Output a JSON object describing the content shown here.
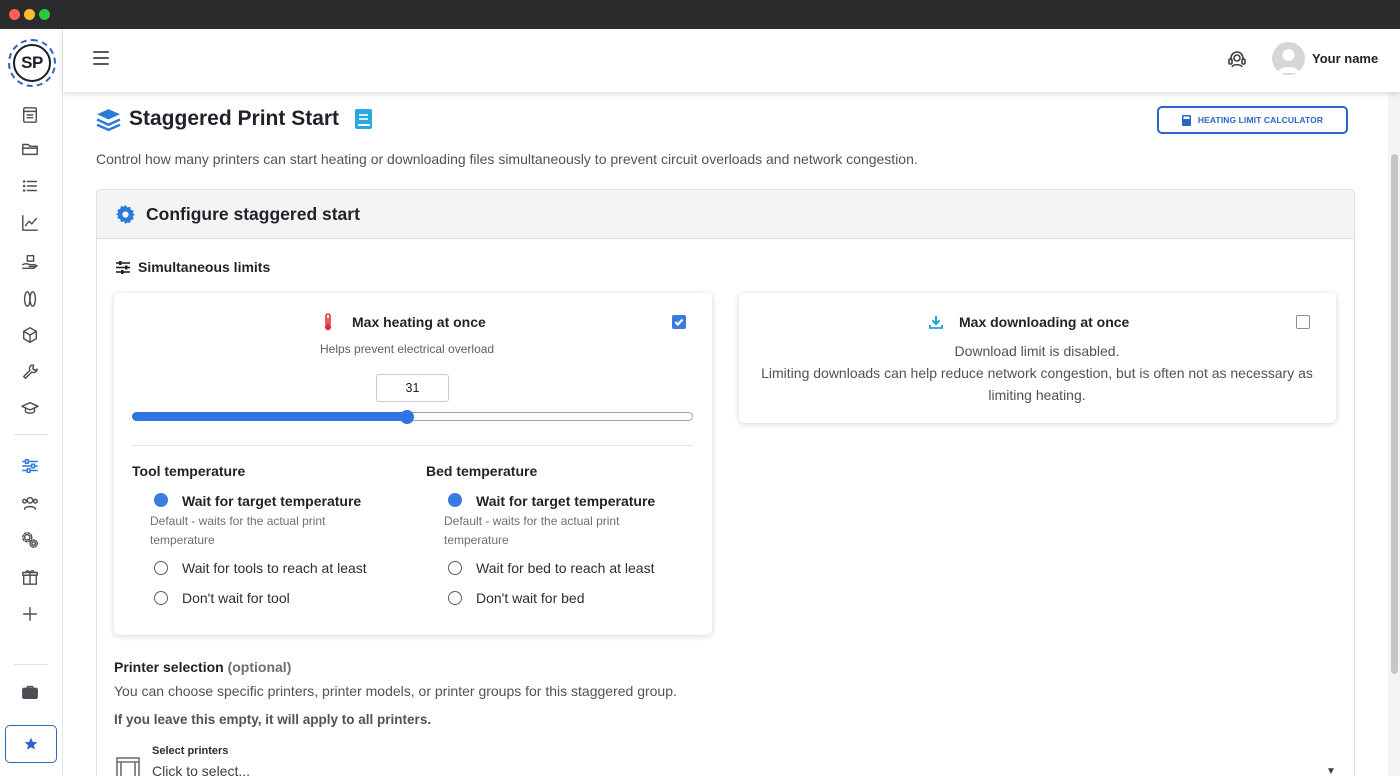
{
  "app": {
    "logo_text": "SP",
    "username": "Your name"
  },
  "colors": {
    "accent": "#2a66c9",
    "slider": "#2f74e0",
    "heat_icon": "#e0303c",
    "download_icon": "#1ea3d8"
  },
  "sidebar": {
    "items": [
      {
        "icon": "dashboard-icon"
      },
      {
        "icon": "folder-icon"
      },
      {
        "icon": "list-icon"
      },
      {
        "icon": "chart-icon"
      },
      {
        "icon": "hand-box-icon"
      },
      {
        "icon": "spool-icon"
      },
      {
        "icon": "cube-icon"
      },
      {
        "icon": "wrench-icon"
      },
      {
        "icon": "graduation-cap-icon"
      },
      {
        "icon": "sliders-icon",
        "active": true
      },
      {
        "icon": "users-icon"
      },
      {
        "icon": "gears-icon"
      },
      {
        "icon": "gift-icon"
      },
      {
        "icon": "plus-icon"
      },
      {
        "icon": "briefcase-icon"
      },
      {
        "icon": "star-icon"
      }
    ]
  },
  "page": {
    "title": "Staggered Print Start",
    "calculator_button": "HEATING LIMIT CALCULATOR",
    "description": "Control how many printers can start heating or downloading files simultaneously to prevent circuit overloads and network congestion."
  },
  "configure": {
    "title": "Configure staggered start",
    "limits_title": "Simultaneous limits",
    "heating": {
      "title": "Max heating at once",
      "enabled": true,
      "help": "Helps prevent electrical overload",
      "value": "31",
      "slider_fraction": 0.49,
      "tool": {
        "title": "Tool temperature",
        "options": [
          {
            "label": "Wait for target temperature",
            "desc": "Default - waits for the actual print temperature",
            "selected": true
          },
          {
            "label": "Wait for tools to reach at least",
            "selected": false
          },
          {
            "label": "Don't wait for tool",
            "selected": false
          }
        ]
      },
      "bed": {
        "title": "Bed temperature",
        "options": [
          {
            "label": "Wait for target temperature",
            "desc": "Default - waits for the actual print temperature",
            "selected": true
          },
          {
            "label": "Wait for bed to reach at least",
            "selected": false
          },
          {
            "label": "Don't wait for bed",
            "selected": false
          }
        ]
      }
    },
    "downloading": {
      "title": "Max downloading at once",
      "enabled": false,
      "message_line1": "Download limit is disabled.",
      "message_line2": "Limiting downloads can help reduce network congestion, but is often not as necessary as limiting heating."
    }
  },
  "printer_selection": {
    "title": "Printer selection",
    "optional": "(optional)",
    "description": "You can choose specific printers, printer models, or printer groups for this staggered group.",
    "note": "If you leave this empty, it will apply to all printers.",
    "select_label": "Select printers",
    "select_placeholder": "Click to select..."
  }
}
